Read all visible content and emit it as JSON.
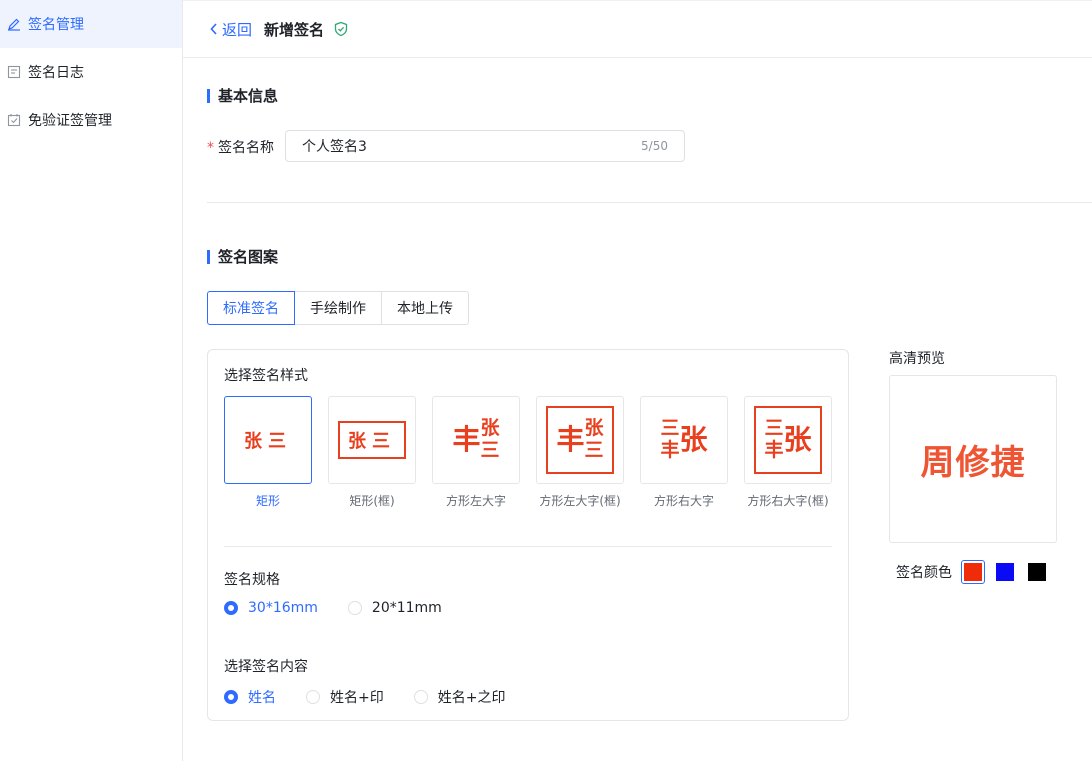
{
  "sidebar": {
    "items": [
      {
        "label": "签名管理",
        "icon": "pen-icon",
        "active": true
      },
      {
        "label": "签名日志",
        "icon": "log-icon",
        "active": false
      },
      {
        "label": "免验证签管理",
        "icon": "verify-icon",
        "active": false
      }
    ]
  },
  "header": {
    "back_label": "返回",
    "title": "新增签名",
    "shield_icon": "shield-check-icon"
  },
  "basic_info": {
    "section_title": "基本信息",
    "name_label": "签名名称",
    "required_mark": "*",
    "name_value": "个人签名3",
    "name_counter": "5/50"
  },
  "pattern": {
    "section_title": "签名图案",
    "tabs": [
      {
        "label": "标准签名",
        "active": true
      },
      {
        "label": "手绘制作",
        "active": false
      },
      {
        "label": "本地上传",
        "active": false
      }
    ],
    "style_label": "选择签名样式",
    "styles": [
      {
        "caption": "矩形",
        "selected": true,
        "chars": [
          "张",
          "三"
        ]
      },
      {
        "caption": "矩形(框)",
        "selected": false,
        "chars": [
          "张",
          "三"
        ]
      },
      {
        "caption": "方形左大字",
        "selected": false,
        "big": "丰",
        "small": [
          "张",
          "三"
        ]
      },
      {
        "caption": "方形左大字(框)",
        "selected": false,
        "big": "丰",
        "small": [
          "张",
          "三"
        ]
      },
      {
        "caption": "方形右大字",
        "selected": false,
        "big": "张",
        "small": [
          "三",
          "丰"
        ]
      },
      {
        "caption": "方形右大字(框)",
        "selected": false,
        "big": "张",
        "small": [
          "三",
          "丰"
        ]
      }
    ],
    "size_label": "签名规格",
    "sizes": [
      {
        "label": "30*16mm",
        "checked": true
      },
      {
        "label": "20*11mm",
        "checked": false
      }
    ],
    "content_label": "选择签名内容",
    "contents": [
      {
        "label": "姓名",
        "checked": true
      },
      {
        "label": "姓名+印",
        "checked": false
      },
      {
        "label": "姓名+之印",
        "checked": false
      }
    ]
  },
  "preview": {
    "label": "高清预览",
    "text": "周修捷",
    "color_label": "签名颜色",
    "colors": [
      {
        "name": "red",
        "hex": "#f02b0a",
        "selected": true
      },
      {
        "name": "blue",
        "hex": "#0a0af5",
        "selected": false
      },
      {
        "name": "black",
        "hex": "#000000",
        "selected": false
      }
    ]
  },
  "theme": {
    "accent": "#2f6bff",
    "seal_red": "#e8401f"
  }
}
